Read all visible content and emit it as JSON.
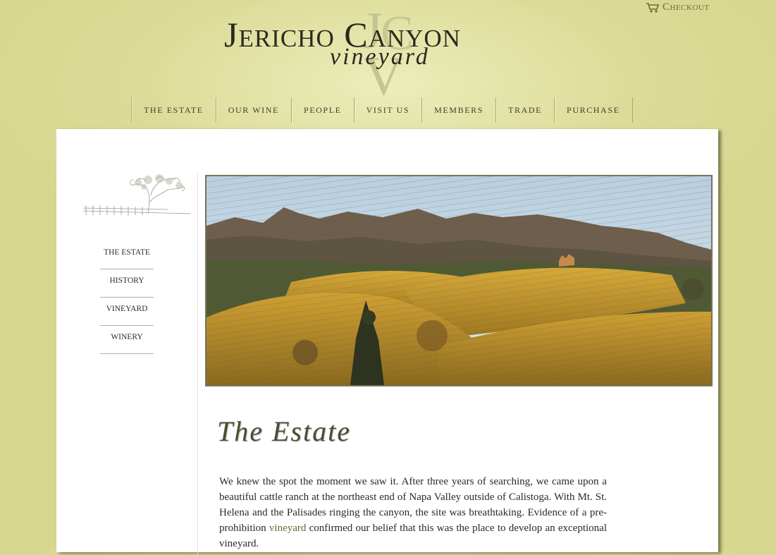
{
  "header": {
    "checkout_label": "Checkout",
    "logo_title": "Jericho Canyon",
    "logo_subtitle": "vineyard",
    "logo_monogram": "JCV"
  },
  "nav": {
    "items": [
      {
        "label": "The Estate"
      },
      {
        "label": "Our Wine"
      },
      {
        "label": "People"
      },
      {
        "label": "Visit Us"
      },
      {
        "label": "Members"
      },
      {
        "label": "Trade"
      },
      {
        "label": "Purchase"
      }
    ]
  },
  "sidebar": {
    "items": [
      {
        "label": "The Estate"
      },
      {
        "label": "History"
      },
      {
        "label": "Vineyard"
      },
      {
        "label": "Winery"
      }
    ]
  },
  "main": {
    "heading": "The Estate",
    "paragraph_start": "We knew the spot the moment we saw it. After three years of searching, we came upon a beautiful cattle ranch at the northeast end of Napa Valley outside of Calistoga. With Mt. St. Helena and the Palisades ringing the canyon, the site was breathtaking. Evidence of a pre-prohibition ",
    "paragraph_link": "vineyard",
    "paragraph_end": " confirmed our belief that this was the place to develop an exceptional vineyard."
  },
  "colors": {
    "background": "#d8d894",
    "panel": "#ffffff",
    "link": "#6b6a3c",
    "text": "#2a2a2a"
  }
}
